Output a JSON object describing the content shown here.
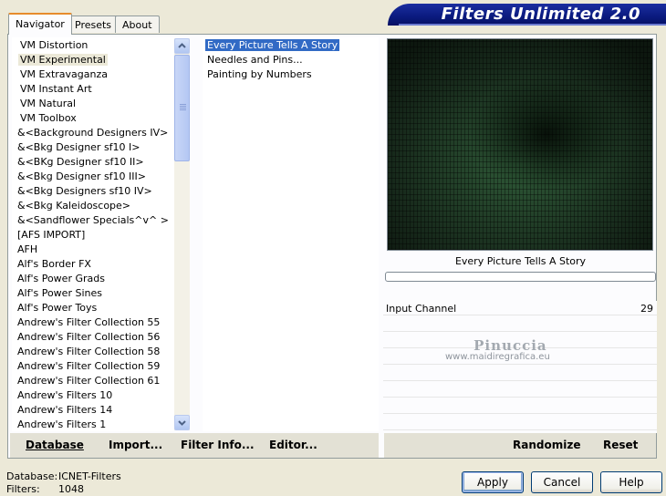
{
  "window": {
    "title": "Filters Unlimited 2.0"
  },
  "tabs": [
    {
      "label": "Navigator"
    },
    {
      "label": "Presets"
    },
    {
      "label": "About"
    }
  ],
  "categories": {
    "items": [
      "VM Distortion",
      "VM Experimental",
      "VM Extravaganza",
      "VM Instant Art",
      "VM Natural",
      "VM Toolbox",
      "&<Background Designers IV>",
      "&<Bkg Designer sf10 I>",
      "&<BKg Designer sf10 II>",
      "&<Bkg Designer sf10 III>",
      "&<Bkg Designers sf10 IV>",
      "&<Bkg Kaleidoscope>",
      "&<Sandflower Specials^v^ >",
      "[AFS IMPORT]",
      "AFH",
      "Alf's Border FX",
      "Alf's Power Grads",
      "Alf's Power Sines",
      "Alf's Power Toys",
      "Andrew's Filter Collection 55",
      "Andrew's Filter Collection 56",
      "Andrew's Filter Collection 58",
      "Andrew's Filter Collection 59",
      "Andrew's Filter Collection 61",
      "Andrew's Filters 10",
      "Andrew's Filters 14",
      "Andrew's Filters 1"
    ],
    "selected": "VM Experimental"
  },
  "filters": {
    "items": [
      "Every Picture Tells A Story",
      "Needles and Pins...",
      "Painting by Numbers"
    ],
    "selected": "Every Picture Tells A Story"
  },
  "preview": {
    "filter_name": "Every Picture Tells A Story",
    "progress": 0
  },
  "parameters": [
    {
      "name": "Input Channel",
      "value": "29"
    }
  ],
  "watermark": {
    "line1": "Pinuccia",
    "line2": "www.maidiregrafica.eu"
  },
  "left_toolbar": {
    "database": "Database",
    "import": "Import...",
    "filter_info": "Filter Info...",
    "editor": "Editor..."
  },
  "right_toolbar": {
    "randomize": "Randomize",
    "reset": "Reset"
  },
  "status": {
    "database_label": "Database:",
    "database_value": "ICNET-Filters",
    "filters_label": "Filters:",
    "filters_value": "1048"
  },
  "buttons": {
    "apply": "Apply",
    "cancel": "Cancel",
    "help": "Help"
  },
  "colors": {
    "banner": "#0a1a7e",
    "selection": "#316ac5",
    "tab_accent": "#e68b2c"
  }
}
